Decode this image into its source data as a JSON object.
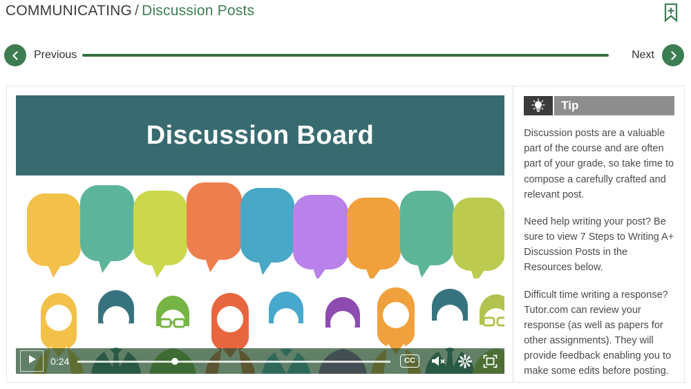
{
  "header": {
    "breadcrumb_course": "COMMUNICATING",
    "breadcrumb_separator": "/",
    "breadcrumb_current": "Discussion Posts",
    "bookmark_icon": "bookmark-plus-icon"
  },
  "nav": {
    "previous_label": "Previous",
    "next_label": "Next",
    "prev_icon": "chevron-left-icon",
    "next_icon": "chevron-right-icon"
  },
  "video": {
    "title": "Discussion Board",
    "current_time": "0:24",
    "progress_percent": 31,
    "play_icon": "play-icon",
    "cc_label": "CC",
    "mute_icon": "speaker-muted-icon",
    "settings_icon": "gear-icon",
    "fullscreen_icon": "fullscreen-icon",
    "banner_color": "#386b70",
    "bubble_colors": [
      "#f3c04a",
      "#5fb39a",
      "#cdd94a",
      "#ee7f4f",
      "#4aa8c4",
      "#b983e8",
      "#f0a03c",
      "#5fb598",
      "#bccb4e"
    ],
    "figure_colors": [
      "#f3c04a",
      "#37737e",
      "#76b444",
      "#e8663f",
      "#46a8cc",
      "#8e4bb0",
      "#f0a03c",
      "#37737e",
      "#b2c24e"
    ]
  },
  "tip": {
    "badge_icon": "lightbulb-icon",
    "title": "Tip",
    "paragraphs": [
      "Discussion posts are a valuable part of the course and are often part of your grade, so take time to compose a carefully crafted and relevant post.",
      "Need help writing your post? Be sure to view 7 Steps to Writing A+ Discussion Posts in the Resources below.",
      "Difficult time writing a response? Tutor.com can review your response (as well as papers for other assignments). They will provide feedback enabling you to make some edits before posting."
    ]
  },
  "colors": {
    "accent_green": "#3c7d52",
    "rule_green": "#33713f",
    "teal": "#386b70",
    "tip_gray": "#8e8e8e",
    "tip_dark": "#3b3b3b"
  }
}
